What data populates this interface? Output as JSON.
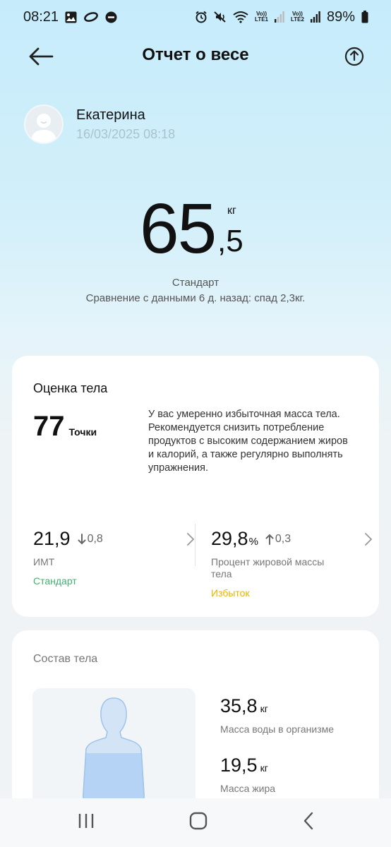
{
  "status_bar": {
    "time": "08:21",
    "battery": "89%",
    "sim1": "LTE1",
    "sim2": "LTE2",
    "volte": "Vo))",
    "wifi_label": "6"
  },
  "header": {
    "title": "Отчет о весе"
  },
  "profile": {
    "name": "Екатерина",
    "datetime": "16/03/2025 08:18"
  },
  "weight": {
    "integer": "65",
    "fraction": ",5",
    "unit": "кг",
    "status": "Стандарт",
    "comparison": "Сравнение с данными 6 д. назад: спад 2,3кг."
  },
  "evaluation": {
    "title": "Оценка тела",
    "score": "77",
    "score_label": "Точки",
    "text": "У вас умеренно избыточная масса тела. Рекомендуется снизить потребление продуктов с высоким содержанием жиров и калорий, а также регулярно выполнять упражнения.",
    "bmi": {
      "value": "21,9",
      "delta": "0,8",
      "delta_direction": "down",
      "name": "ИМТ",
      "status": "Стандарт",
      "status_color": "#3cb371"
    },
    "fat": {
      "value": "29,8",
      "unit": "%",
      "delta": "0,3",
      "delta_direction": "up",
      "name": "Процент жировой массы тела",
      "status": "Избыток",
      "status_color": "#e8b400"
    }
  },
  "composition": {
    "title": "Состав тела",
    "water": {
      "value": "35,8",
      "unit": "кг",
      "name": "Масса воды в организме"
    },
    "fat_mass": {
      "value": "19,5",
      "unit": "кг",
      "name": "Масса жира"
    }
  },
  "icons": {
    "back": "arrow-left-icon",
    "share": "share-icon",
    "nav_recent": "recent-apps-icon",
    "nav_home": "home-icon",
    "nav_back": "nav-back-icon"
  }
}
